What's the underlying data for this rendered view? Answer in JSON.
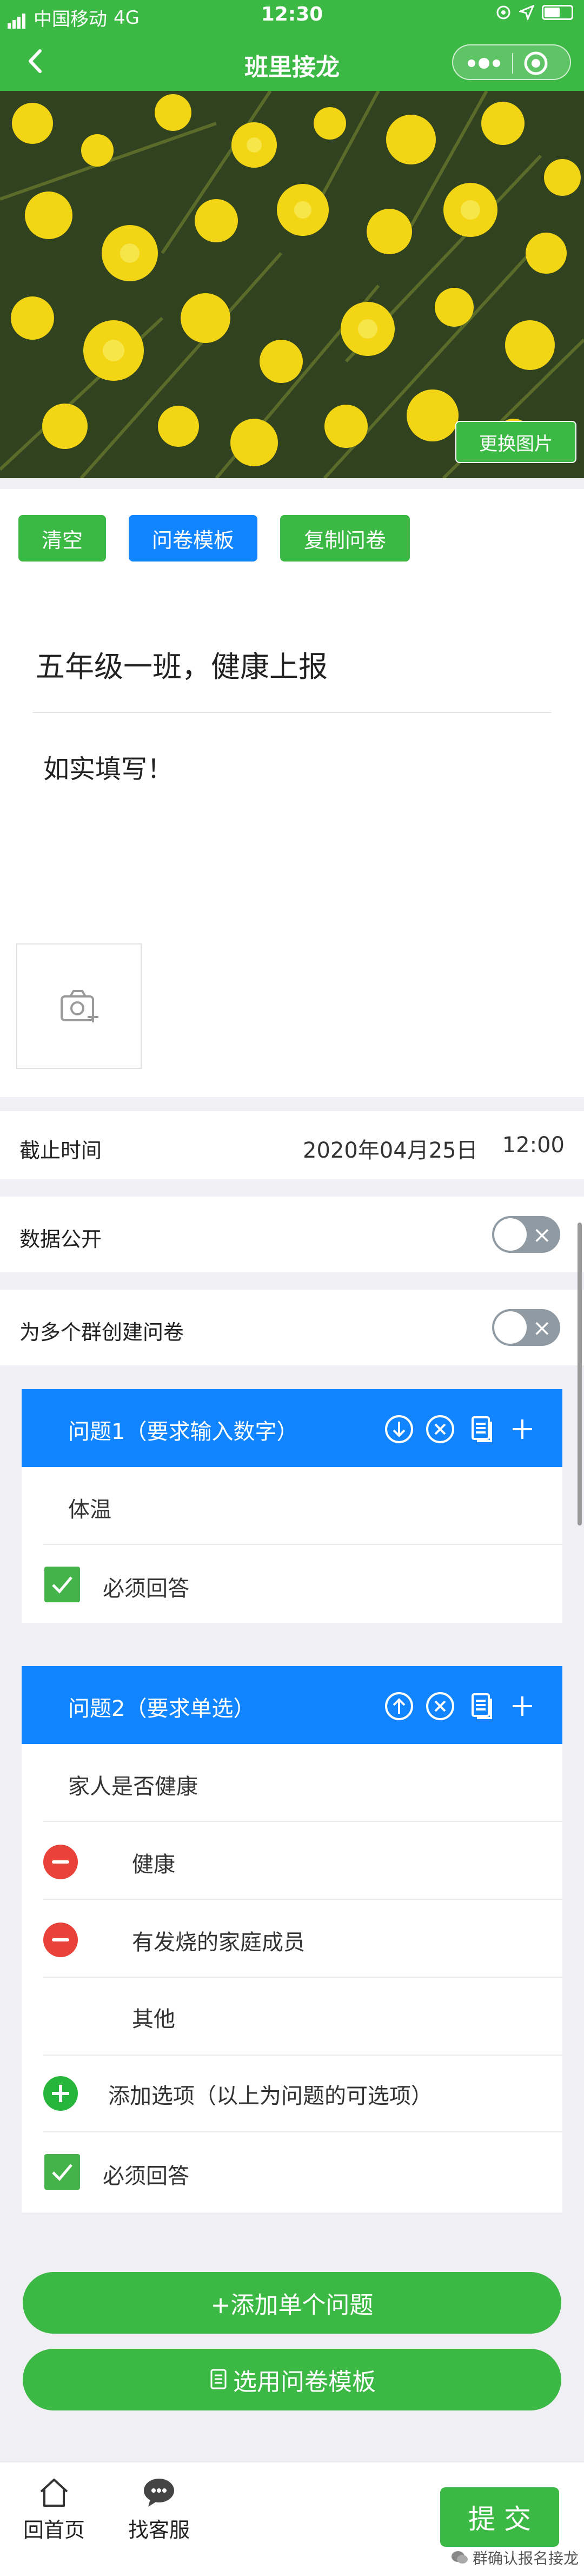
{
  "statusbar": {
    "carrier": "中国移动",
    "network": "4G",
    "time": "12:30"
  },
  "navbar": {
    "title": "班里接龙"
  },
  "banner": {
    "change_image_label": "更换图片"
  },
  "toolbar": {
    "clear_label": "清空",
    "template_label": "问卷模板",
    "copy_label": "复制问卷"
  },
  "survey": {
    "title": "五年级一班，健康上报",
    "description": "如实填写！"
  },
  "deadline": {
    "label": "截止时间",
    "date": "2020年04月25日",
    "time": "12:00"
  },
  "settings": {
    "public_data_label": "数据公开",
    "multi_group_label": "为多个群创建问卷"
  },
  "question1": {
    "header": "问题1（要求输入数字）",
    "text": "体温",
    "required_label": "必须回答"
  },
  "question2": {
    "header": "问题2（要求单选）",
    "text": "家人是否健康",
    "options": [
      "健康",
      "有发烧的家庭成员",
      "其他"
    ],
    "add_option_label": "添加选项（以上为问题的可选项）",
    "required_label": "必须回答"
  },
  "actions": {
    "add_question_label": "+添加单个问题",
    "use_template_label": "选用问卷模板"
  },
  "tabbar": {
    "home_label": "回首页",
    "service_label": "找客服",
    "submit_label": "提 交"
  },
  "watermark": {
    "text": "群确认报名接龙"
  },
  "colors": {
    "brand_green": "#3cb844",
    "question_blue": "#1185ff",
    "remove_red": "#e8423a"
  }
}
